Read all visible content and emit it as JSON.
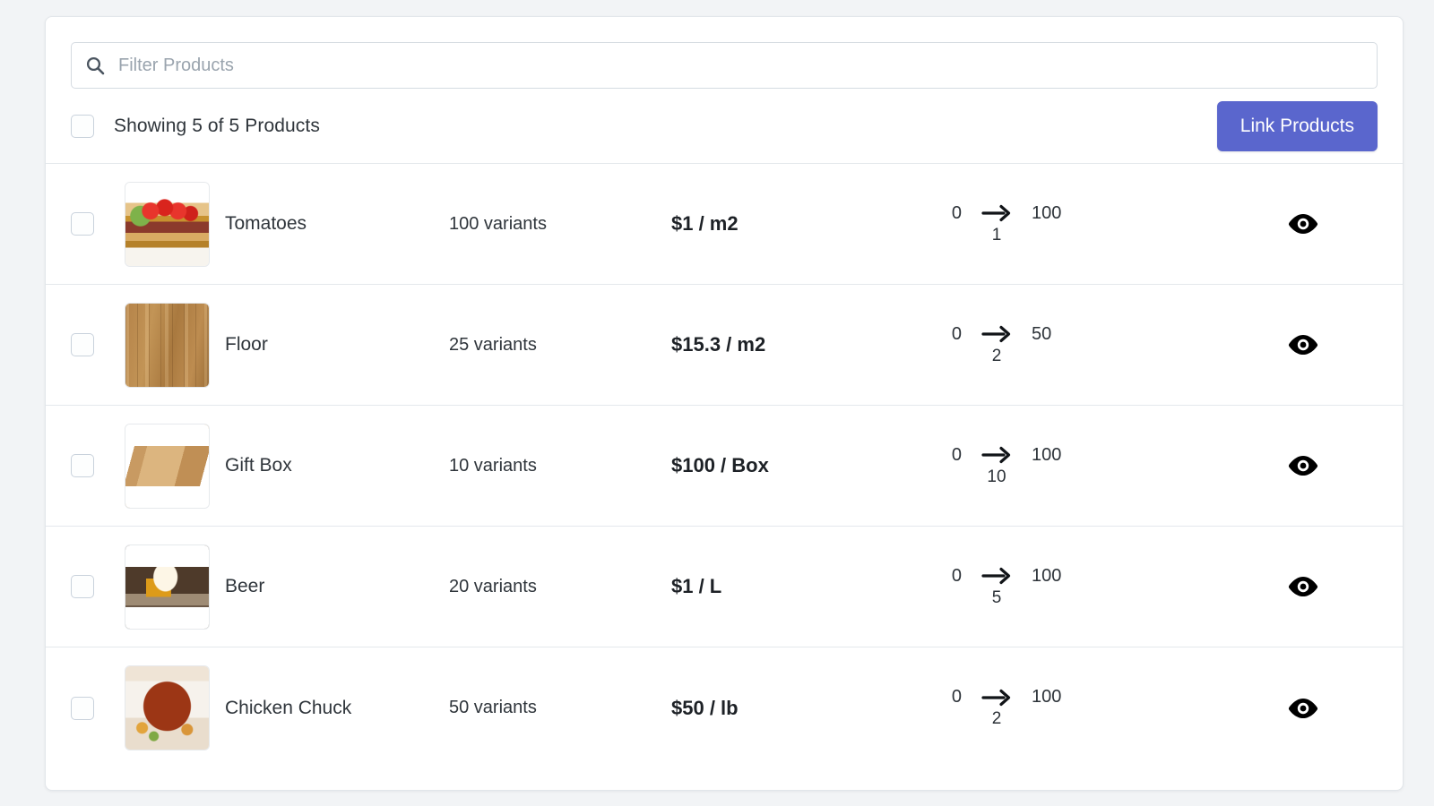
{
  "search": {
    "placeholder": "Filter Products",
    "value": "",
    "icon": "search-icon"
  },
  "toolbar": {
    "select_all_checked": false,
    "showing_text": "Showing 5 of 5 Products",
    "link_products_label": "Link Products",
    "primary_color": "#5a66cd"
  },
  "columns": {
    "name": "",
    "variants": "",
    "price": "",
    "quantity": "",
    "preview": ""
  },
  "products": [
    {
      "checked": false,
      "thumb": "tomatoes-thumbnail",
      "name": "Tomatoes",
      "variants": "100 variants",
      "price": "$1 / m2",
      "qty_from": "0",
      "qty_arrow": "arrow-right-icon",
      "qty_step": "1",
      "qty_to": "100",
      "preview_icon": "eye-icon"
    },
    {
      "checked": false,
      "thumb": "floor-thumbnail",
      "name": "Floor",
      "variants": "25 variants",
      "price": "$15.3 / m2",
      "qty_from": "0",
      "qty_arrow": "arrow-right-icon",
      "qty_step": "2",
      "qty_to": "50",
      "preview_icon": "eye-icon"
    },
    {
      "checked": false,
      "thumb": "gift-box-thumbnail",
      "name": "Gift Box",
      "variants": "10 variants",
      "price": "$100 / Box",
      "qty_from": "0",
      "qty_arrow": "arrow-right-icon",
      "qty_step": "10",
      "qty_to": "100",
      "preview_icon": "eye-icon"
    },
    {
      "checked": false,
      "thumb": "beer-thumbnail",
      "name": "Beer",
      "variants": "20 variants",
      "price": "$1 / L",
      "qty_from": "0",
      "qty_arrow": "arrow-right-icon",
      "qty_step": "5",
      "qty_to": "100",
      "preview_icon": "eye-icon"
    },
    {
      "checked": false,
      "thumb": "chicken-chuck-thumbnail",
      "name": "Chicken Chuck",
      "variants": "50 variants",
      "price": "$50 / lb",
      "qty_from": "0",
      "qty_arrow": "arrow-right-icon",
      "qty_step": "2",
      "qty_to": "100",
      "preview_icon": "eye-icon"
    }
  ]
}
